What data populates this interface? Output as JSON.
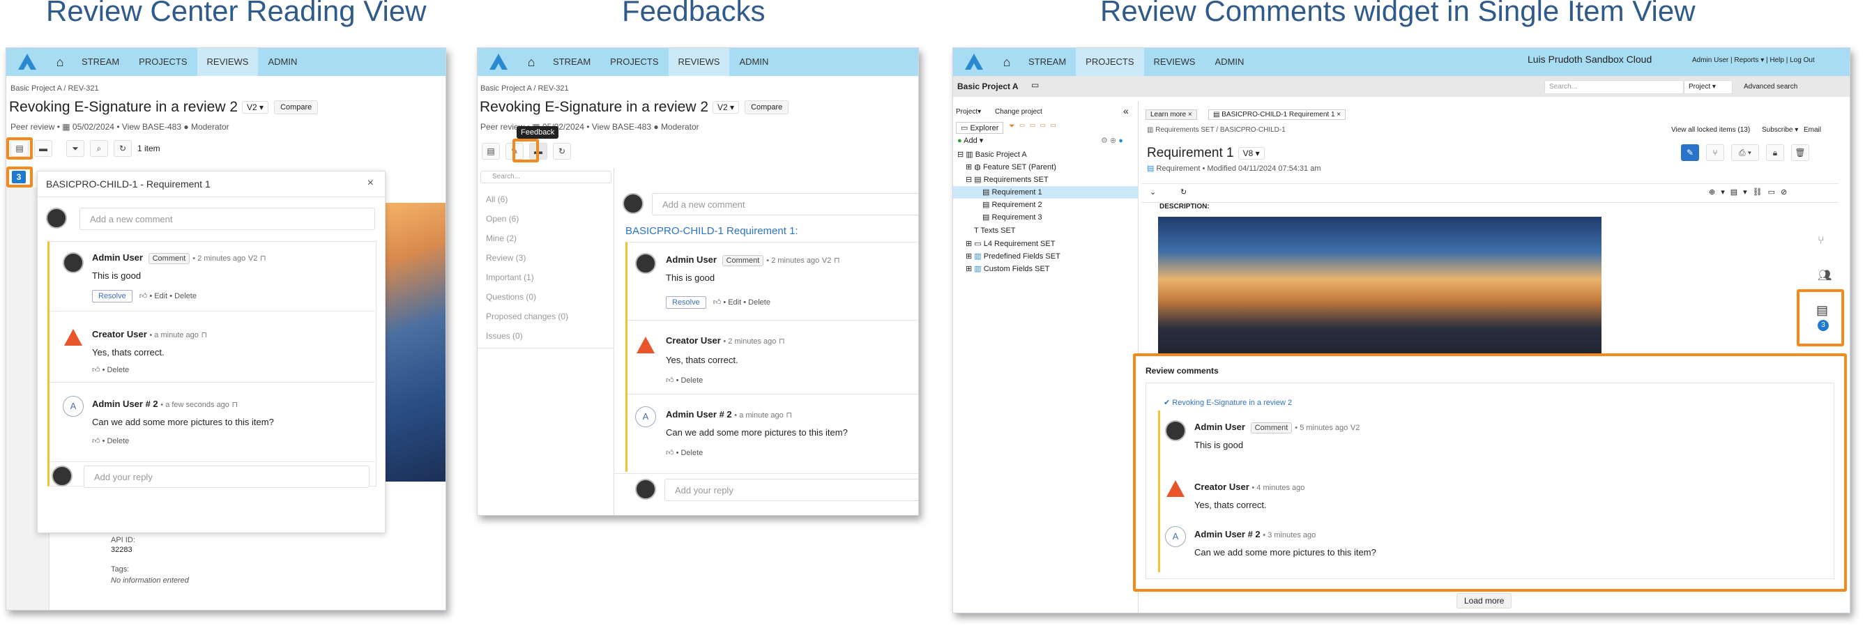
{
  "captions": {
    "left": "Review Center Reading View",
    "middle": "Feedbacks",
    "right": "Review Comments widget in Single Item View"
  },
  "nav": {
    "stream": "STREAM",
    "projects": "PROJECTS",
    "reviews": "REVIEWS",
    "admin": "ADMIN"
  },
  "review": {
    "breadcrumb": "Basic Project A  /  REV-321",
    "title": "Revoking E-Signature in a review 2",
    "version": "V2",
    "compare": "Compare",
    "meta_type": "Peer review",
    "meta_date": "05/02/2024",
    "meta_view": "View BASE-483",
    "meta_role": "Moderator",
    "item_count": "1 item",
    "badge": "3",
    "tooltip": "Feedback"
  },
  "left_panel": {
    "title": "BASICPRO-CHILD-1 - Requirement 1",
    "close": "×",
    "add_placeholder": "Add a new comment",
    "reply_placeholder": "Add your reply",
    "api_label": "API ID:",
    "api_value": "32283",
    "tags_label": "Tags:",
    "tags_value": "No information entered"
  },
  "comments": [
    {
      "author": "Admin User",
      "tag": "Comment",
      "time": "• 2 minutes ago",
      "ver": "V2",
      "text": "This is good",
      "resolve": "Resolve",
      "actions": "• Edit • Delete"
    },
    {
      "author": "Creator User",
      "time": "• a minute ago",
      "text": "Yes, thats correct.",
      "actions": "• Delete"
    },
    {
      "author": "Admin User # 2",
      "avatar": "A",
      "time": "• a few seconds ago",
      "text": "Can we add some more pictures to this item?",
      "actions": "• Delete"
    }
  ],
  "middle": {
    "search": "Search...",
    "filters": [
      "All (6)",
      "Open (6)",
      "Mine (2)",
      "Review (3)",
      "Important (1)",
      "Questions (0)",
      "Proposed changes (0)",
      "Issues (0)"
    ],
    "add_placeholder": "Add a new comment",
    "item_heading": "BASICPRO-CHILD-1 Requirement 1:",
    "times": [
      "• 2 minutes ago",
      "• 2 minutes ago",
      "• a minute ago"
    ],
    "reply_placeholder": "Add your reply"
  },
  "right": {
    "cloud": "Luis Prudoth Sandbox Cloud",
    "user": "Admin User",
    "reports": "Reports ▾",
    "help": "Help",
    "logout": "Log Out",
    "project": "Basic Project A",
    "search": "Search...",
    "search_scope": "Project",
    "advanced": "Advanced search",
    "project_menu": "Project▾",
    "change_project": "Change project",
    "explorer": "Explorer",
    "add": "Add ▾",
    "learn_more": "Learn more",
    "tab_item": "BASICPRO-CHILD-1 Requirement 1",
    "crumb": "Requirements SET  /  BASICPRO-CHILD-1",
    "locked": "View all locked items (13)",
    "subscribe": "Subscribe ▾",
    "email": "Email",
    "item_title": "Requirement 1",
    "item_version": "V8",
    "item_meta": "Requirement  •  Modified 04/11/2024 07:54:31 am",
    "description": "DESCRIPTION:",
    "tree": [
      "Basic Project A",
      "Feature SET (Parent)",
      "Requirements SET",
      "Requirement 1",
      "Requirement 2",
      "Requirement 3",
      "Texts SET",
      "L4 Requirement SET",
      "Predefined Fields SET",
      "Custom Fields SET"
    ],
    "widget_title": "Review comments",
    "widget_link": "Revoking E-Signature in a review 2",
    "times": [
      "• 5 minutes ago",
      "• 4 minutes ago",
      "• 3 minutes ago"
    ],
    "load_more": "Load more",
    "side_badge": "3"
  }
}
